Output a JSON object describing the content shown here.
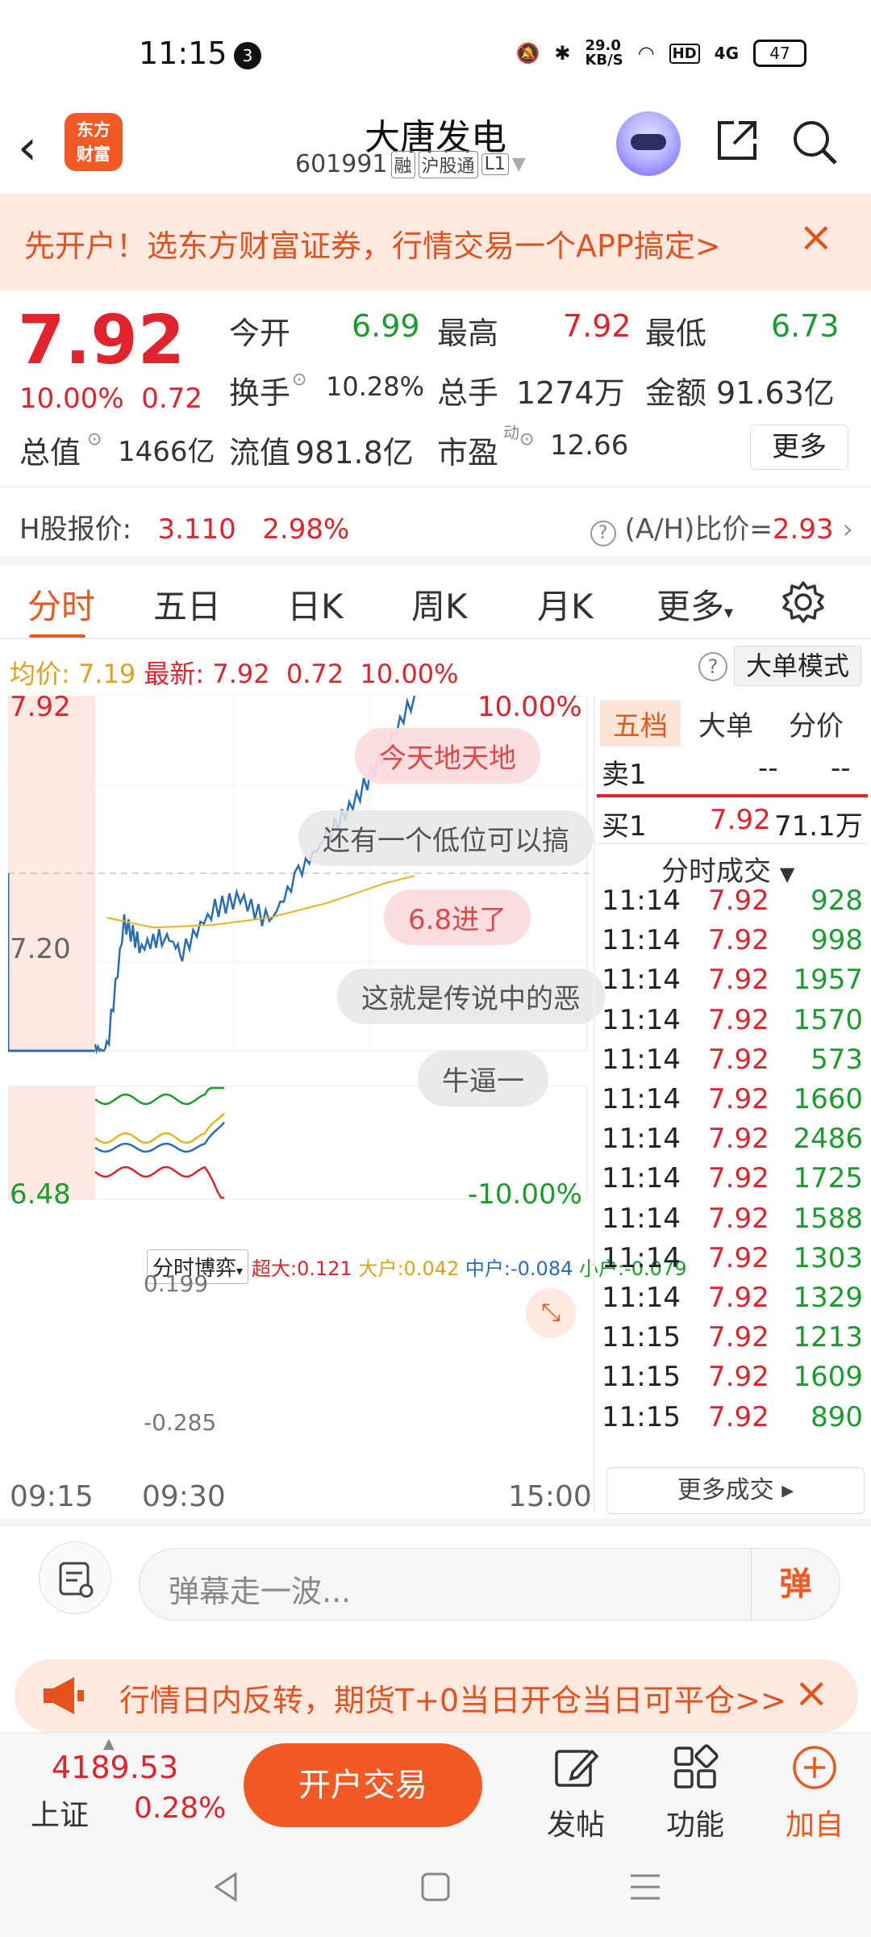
{
  "status_bar": {
    "time": "11:15",
    "notif_count": "3",
    "net_speed": "29.0",
    "net_unit": "KB/S",
    "hd": "HD",
    "signal": "4G",
    "battery": "47"
  },
  "header": {
    "back_icon": "chevron-left-icon",
    "logo_line1": "东方",
    "logo_line2": "财富",
    "stock_name": "大唐发电",
    "stock_code": "601991",
    "tags": [
      "融",
      "沪股通",
      "L1"
    ]
  },
  "banner": {
    "text": "先开户！选东方财富证券，行情交易一个APP搞定>",
    "close": "×"
  },
  "quote": {
    "price": "7.92",
    "change_pct": "10.00%",
    "change": "0.72",
    "open_label": "今开",
    "open": "6.99",
    "high_label": "最高",
    "high": "7.92",
    "low_label": "最低",
    "low": "6.73",
    "turnover_label": "换手",
    "turnover": "10.28%",
    "volume_label": "总手",
    "volume": "1274万",
    "amount_label": "金额",
    "amount": "91.63亿",
    "mktcap_label": "总值",
    "mktcap": "1466亿",
    "float_label": "流值",
    "float_cap": "981.8亿",
    "pe_label": "市盈",
    "pe_sup": "动",
    "pe": "12.66",
    "more": "更多"
  },
  "hshare": {
    "label": "H股报价:",
    "price": "3.110",
    "pct": "2.98%",
    "ratio_label": "(A/H)比价=",
    "ratio": "2.93"
  },
  "tabs": [
    "分时",
    "五日",
    "日K",
    "周K",
    "月K",
    "更多"
  ],
  "avg_bar": {
    "avg_label": "均价:",
    "avg": "7.19",
    "latest_label": "最新:",
    "latest": "7.92",
    "chg": "0.72",
    "pct": "10.00%",
    "mode": "大单模式"
  },
  "chart_labels": {
    "y_top": "7.92",
    "y_mid": "7.20",
    "y_bot": "6.48",
    "pct_top": "10.00%",
    "pct_bot": "-10.00%",
    "sub_top": "0.199",
    "sub_bot": "-0.285",
    "t_start": "09:15",
    "t_open": "09:30",
    "t_end": "15:00"
  },
  "danmu": [
    "今天地天地",
    "还有一个低位可以搞",
    "6.8进了",
    "这就是传说中的恶",
    "牛逼一"
  ],
  "sub_indicator": {
    "select": "分时博弈",
    "super_label": "超大:",
    "super": "0.121",
    "big_label": "大户:",
    "big": "0.042",
    "mid_label": "中户:",
    "mid": "-0.084",
    "small_label": "小户:",
    "small": "-0.079"
  },
  "chart_data": {
    "type": "line",
    "series": [],
    "x_ticks": [
      "09:15",
      "09:30",
      "15:00"
    ],
    "ylim": [
      6.48,
      7.92
    ],
    "y_ticks": [
      "7.92",
      "7.20",
      "6.48"
    ],
    "right_ticks": [
      "10.00%",
      "-10.00%"
    ],
    "price_curve": [
      [
        0,
        6.48
      ],
      [
        0.02,
        6.48
      ],
      [
        0.05,
        7.0
      ],
      [
        0.08,
        6.9
      ],
      [
        0.12,
        6.95
      ],
      [
        0.15,
        6.88
      ],
      [
        0.2,
        7.05
      ],
      [
        0.25,
        7.1
      ],
      [
        0.3,
        7.0
      ],
      [
        0.35,
        7.2
      ],
      [
        0.4,
        7.35
      ],
      [
        0.45,
        7.5
      ],
      [
        0.5,
        7.7
      ],
      [
        0.55,
        7.92
      ]
    ],
    "avg_curve": [
      [
        0.02,
        7.02
      ],
      [
        0.1,
        6.98
      ],
      [
        0.2,
        6.99
      ],
      [
        0.3,
        7.02
      ],
      [
        0.4,
        7.08
      ],
      [
        0.5,
        7.16
      ],
      [
        0.55,
        7.19
      ]
    ]
  },
  "right_panel": {
    "tabs": [
      "五档",
      "大单",
      "分价"
    ],
    "sell1_label": "卖1",
    "sell1_price": "--",
    "sell1_vol": "--",
    "buy1_label": "买1",
    "buy1_price": "7.92",
    "buy1_vol": "71.1万",
    "ticks_title": "分时成交",
    "trades": [
      {
        "t": "11:14",
        "p": "7.92",
        "v": "928"
      },
      {
        "t": "11:14",
        "p": "7.92",
        "v": "998"
      },
      {
        "t": "11:14",
        "p": "7.92",
        "v": "1957"
      },
      {
        "t": "11:14",
        "p": "7.92",
        "v": "1570"
      },
      {
        "t": "11:14",
        "p": "7.92",
        "v": "573"
      },
      {
        "t": "11:14",
        "p": "7.92",
        "v": "1660"
      },
      {
        "t": "11:14",
        "p": "7.92",
        "v": "2486"
      },
      {
        "t": "11:14",
        "p": "7.92",
        "v": "1725"
      },
      {
        "t": "11:14",
        "p": "7.92",
        "v": "1588"
      },
      {
        "t": "11:14",
        "p": "7.92",
        "v": "1303"
      },
      {
        "t": "11:14",
        "p": "7.92",
        "v": "1329"
      },
      {
        "t": "11:15",
        "p": "7.92",
        "v": "1213"
      },
      {
        "t": "11:15",
        "p": "7.92",
        "v": "1609"
      },
      {
        "t": "11:15",
        "p": "7.92",
        "v": "890"
      }
    ],
    "more_trades": "更多成交"
  },
  "comment": {
    "placeholder": "弹幕走一波...",
    "send": "弹"
  },
  "promo": {
    "text": "行情日内反转，期货T+0当日开仓当日可平仓>>",
    "close": "×"
  },
  "bottom": {
    "index_value": "4189.53",
    "index_name": "上证",
    "index_pct": "0.28%",
    "trade": "开户交易",
    "post": "发帖",
    "func": "功能",
    "add": "加自选"
  },
  "colors": {
    "up": "#e1232b",
    "down": "#1a9c2e",
    "accent": "#f15a24",
    "price_line": "#2a6db5",
    "avg_line": "#e6b422"
  }
}
